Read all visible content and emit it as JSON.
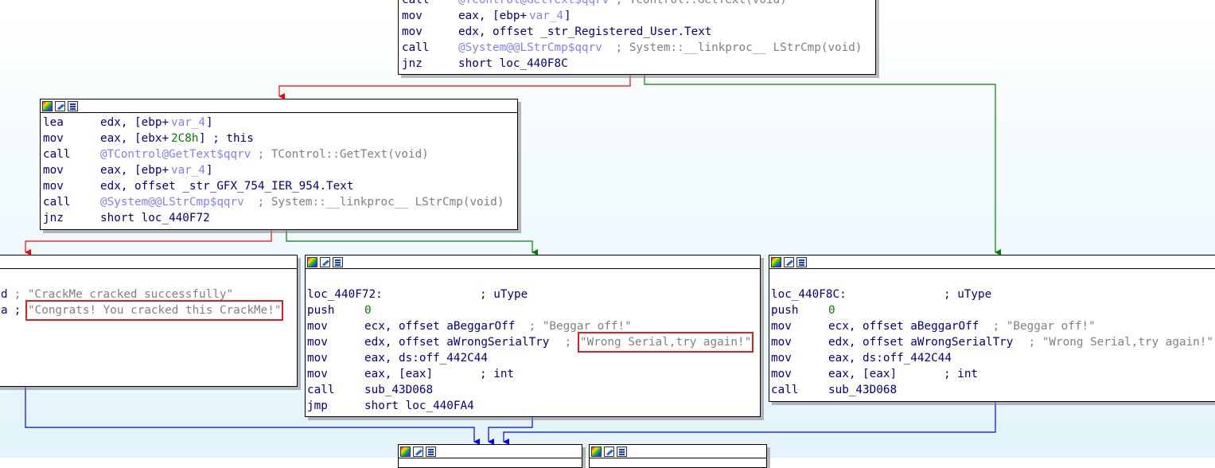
{
  "colors": {
    "edge_false": "#ff0000",
    "edge_true": "#008000",
    "edge_jump": "#0000ff",
    "highlight": "#e02020",
    "mnemonic": "#000080",
    "symbol": "#8080ff",
    "comment": "#808080",
    "number": "#008000"
  },
  "icons": [
    "color-palette-icon",
    "edit-icon",
    "graph-view-icon"
  ],
  "top_block": {
    "lines": [
      {
        "mn": "call",
        "sym": "@TControl@GetText$qqrv",
        "cmt": " ; TControl::GetText(void)"
      },
      {
        "mn": "mov",
        "op": "eax, [ebp+",
        "sym": "var_4",
        "op2": "]"
      },
      {
        "mn": "mov",
        "op": "edx, offset _str_Registered_User.Text"
      },
      {
        "mn": "call",
        "sym": "@System@@LStrCmp$qqrv",
        "cmt": " ; System::__linkproc__ LStrCmp(void)"
      },
      {
        "mn": "jnz",
        "op": "short loc_440F8C"
      }
    ]
  },
  "middle_block": {
    "lines": [
      {
        "mn": "lea",
        "op": "edx, [ebp+",
        "sym": "var_4",
        "op2": "]"
      },
      {
        "mn": "mov",
        "op": "eax, [ebx+",
        "num": "2C8h",
        "op2": "] ; this"
      },
      {
        "mn": "call",
        "sym": "@TControl@GetText$qqrv",
        "cmt": " ; TControl::GetText(void)"
      },
      {
        "mn": "mov",
        "op": "eax, [ebp+",
        "sym": "var_4",
        "op2": "]"
      },
      {
        "mn": "mov",
        "op": "edx, offset _str_GFX_754_IER_954.Text"
      },
      {
        "mn": "call",
        "sym": "@System@@LStrCmp$qqrv",
        "cmt": " ; System::__linkproc__ LStrCmp(void)"
      },
      {
        "mn": "jnz",
        "op": "short loc_440F72"
      }
    ]
  },
  "left_block": {
    "line1_prefix": "d",
    "line1_comment": " ; \"CrackMe cracked successfully\"",
    "line2_prefix": "a",
    "line2_sep": " ; ",
    "line2_string": "\"Congrats! You cracked this CrackMe!\""
  },
  "center_block": {
    "label": "loc_440F72:",
    "label_comment": "; uType",
    "lines": [
      {
        "mn": "push",
        "num": "0"
      },
      {
        "mn": "mov",
        "op": "ecx, offset aBeggarOff",
        "cmt": " ; \"Beggar off!\""
      },
      {
        "mn": "mov",
        "op": "edx, offset aWrongSerialTry",
        "cmt": " ; ",
        "str": "\"Wrong Serial,try again!\""
      },
      {
        "mn": "mov",
        "op": "eax, ds:off_442C44"
      },
      {
        "mn": "mov",
        "op": "eax, [eax]",
        "cmt2": "; int"
      },
      {
        "mn": "call",
        "op": "sub_43D068"
      },
      {
        "mn": "jmp",
        "op": "short loc_440FA4"
      }
    ]
  },
  "right_block": {
    "label": "loc_440F8C:",
    "label_comment": "; uType",
    "lines": [
      {
        "mn": "push",
        "num": "0"
      },
      {
        "mn": "mov",
        "op": "ecx, offset aBeggarOff",
        "cmt": " ; \"Beggar off!\""
      },
      {
        "mn": "mov",
        "op": "edx, offset aWrongSerialTry",
        "cmt": " ; \"Wrong Serial,try again!\""
      },
      {
        "mn": "mov",
        "op": "eax, ds:off_442C44"
      },
      {
        "mn": "mov",
        "op": "eax, [eax]",
        "cmt2": "; int"
      },
      {
        "mn": "call",
        "op": "sub_43D068"
      }
    ]
  }
}
